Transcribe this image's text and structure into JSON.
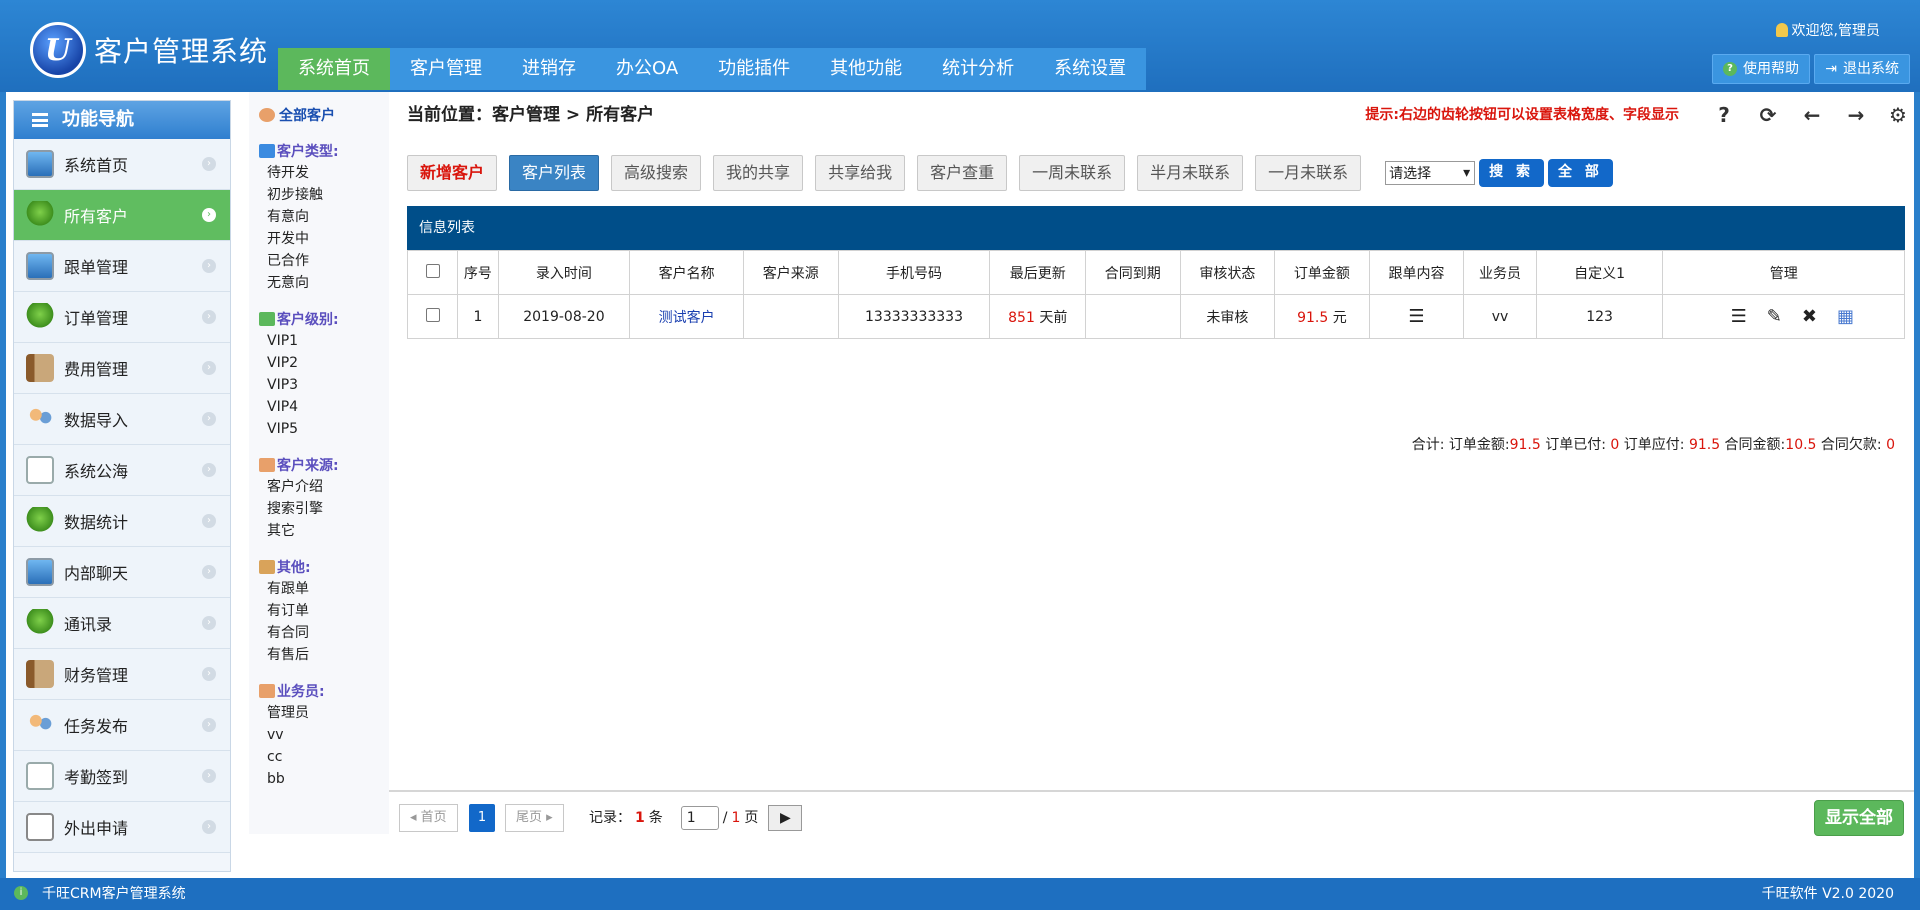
{
  "app": {
    "logo_letter": "U",
    "title": "客户管理系统"
  },
  "topnav": [
    "系统首页",
    "客户管理",
    "进销存",
    "办公OA",
    "功能插件",
    "其他功能",
    "统计分析",
    "系统设置"
  ],
  "header": {
    "welcome": "欢迎您,管理员",
    "help": "使用帮助",
    "logout": "退出系统"
  },
  "leftnav": {
    "title": "功能导航",
    "items": [
      {
        "label": "系统首页",
        "icon": "monitor"
      },
      {
        "label": "所有客户",
        "icon": "tree"
      },
      {
        "label": "跟单管理",
        "icon": "monitor"
      },
      {
        "label": "订单管理",
        "icon": "tree"
      },
      {
        "label": "费用管理",
        "icon": "book"
      },
      {
        "label": "数据导入",
        "icon": "people"
      },
      {
        "label": "系统公海",
        "icon": "mail"
      },
      {
        "label": "数据统计",
        "icon": "tree"
      },
      {
        "label": "内部聊天",
        "icon": "monitor"
      },
      {
        "label": "通讯录",
        "icon": "tree"
      },
      {
        "label": "财务管理",
        "icon": "book"
      },
      {
        "label": "任务发布",
        "icon": "people"
      },
      {
        "label": "考勤签到",
        "icon": "mail"
      },
      {
        "label": "外出申请",
        "icon": "note"
      }
    ]
  },
  "filters": {
    "all": "全部客户",
    "groups": [
      {
        "title": "客户类型:",
        "items": [
          "待开发",
          "初步接触",
          "有意向",
          "开发中",
          "已合作",
          "无意向"
        ]
      },
      {
        "title": "客户级别:",
        "items": [
          "VIP1",
          "VIP2",
          "VIP3",
          "VIP4",
          "VIP5"
        ]
      },
      {
        "title": "客户来源:",
        "items": [
          "客户介绍",
          "搜索引擎",
          "其它"
        ]
      },
      {
        "title": "其他:",
        "items": [
          "有跟单",
          "有订单",
          "有合同",
          "有售后"
        ]
      },
      {
        "title": "业务员:",
        "items": [
          "管理员",
          "vv",
          "cc",
          "bb"
        ]
      }
    ]
  },
  "breadcrumb": "当前位置：客户管理 > 所有客户",
  "tip": "提示:右边的齿轮按钮可以设置表格宽度、字段显示",
  "toolbar": {
    "buttons": [
      "新增客户",
      "客户列表",
      "高级搜索",
      "我的共享",
      "共享给我",
      "客户查重",
      "一周未联系",
      "半月未联系",
      "一月未联系"
    ],
    "select": "请选择",
    "search": "搜 索",
    "all": "全 部"
  },
  "table": {
    "caption": "信息列表",
    "columns": [
      "",
      "序号",
      "录入时间",
      "客户名称",
      "客户来源",
      "手机号码",
      "最后更新",
      "合同到期",
      "审核状态",
      "订单金额",
      "跟单内容",
      "业务员",
      "自定义1",
      "管理"
    ],
    "rows": [
      {
        "no": "1",
        "date": "2019-08-20",
        "name": "测试客户",
        "source": "",
        "phone": "13333333333",
        "updated_num": "851",
        "updated_unit": " 天前",
        "contract": "",
        "status": "未审核",
        "amount_num": "91.5",
        "amount_unit": " 元",
        "salesman": "vv",
        "custom1": "123"
      }
    ]
  },
  "totals": {
    "t1": "合计:  订单金额:",
    "v1": "91.5",
    "t2": " 订单已付: ",
    "v2": "0",
    "t3": " 订单应付: ",
    "v3": "91.5",
    "t4": "   合同金额:",
    "v4": "10.5",
    "t5": " 合同欠款: ",
    "v5": "0"
  },
  "pager": {
    "first": "◂ 首页",
    "page": "1",
    "last": "尾页 ▸",
    "records_label": "记录：",
    "records": "1",
    "records_unit": "条",
    "current": "1",
    "total": "1",
    "page_unit": "页",
    "go": "▶",
    "show_all": "显示全部"
  },
  "footer": {
    "left": "千旺CRM客户管理系统",
    "right": "千旺软件 V2.0 2020"
  }
}
